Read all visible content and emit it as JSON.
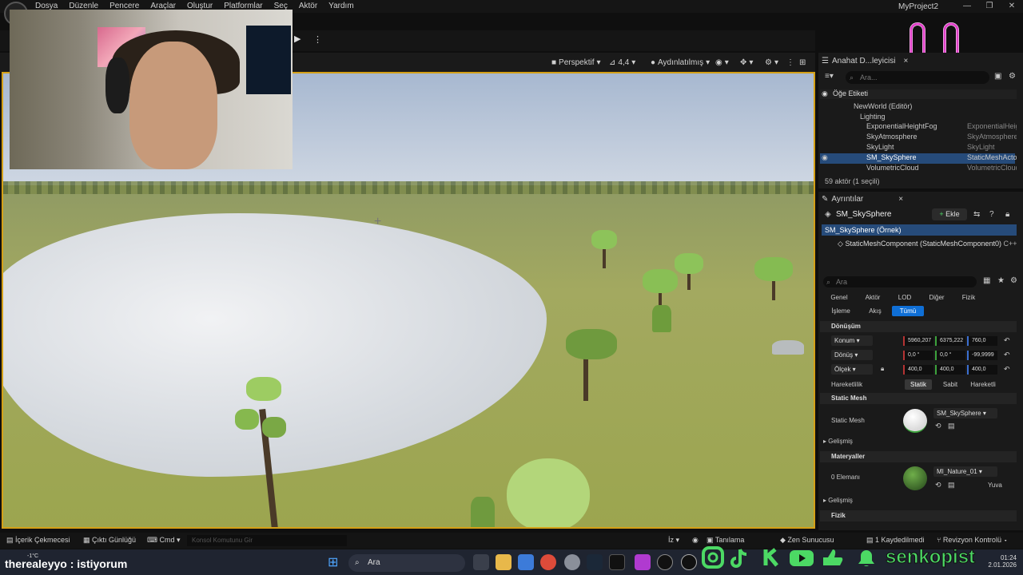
{
  "menu": {
    "items": [
      "Dosya",
      "Düzenle",
      "Pencere",
      "Araçlar",
      "Oluştur",
      "Platformlar",
      "Seç",
      "Aktör",
      "Yardım"
    ],
    "project_title": "MyProject2"
  },
  "viewport": {
    "perspective_label": "Perspektif",
    "fov_label": "4,4",
    "lighting_label": "Aydınlatılmış"
  },
  "outliner": {
    "tab_label": "Anahat D...leyicisi",
    "search_placeholder": "Ara...",
    "column_label": "Öğe Etiketi",
    "rows": [
      {
        "name": "NewWorld (Editör)",
        "type": ""
      },
      {
        "name": "Lighting",
        "type": ""
      },
      {
        "name": "ExponentialHeightFog",
        "type": "ExponentialHeig"
      },
      {
        "name": "SkyAtmosphere",
        "type": "SkyAtmosphere"
      },
      {
        "name": "SkyLight",
        "type": "SkyLight"
      },
      {
        "name": "SM_SkySphere",
        "type": "StaticMeshActo"
      },
      {
        "name": "VolumetricCloud",
        "type": "VolumetricCloud"
      }
    ],
    "actor_count": "59 aktör (1 seçili)"
  },
  "details": {
    "tab_label": "Ayrıntılar",
    "actor_name": "SM_SkySphere",
    "add_label": "Ekle",
    "instance_label": "SM_SkySphere (Örnek)",
    "component_label": "StaticMeshComponent (StaticMeshComponent0)",
    "component_tag": "C++ S",
    "search_placeholder": "Ara",
    "filters_row1": [
      "Genel",
      "Aktör",
      "LOD",
      "Diğer",
      "Fizik"
    ],
    "filters_row2": [
      "İşleme",
      "Akış",
      "Tümü"
    ],
    "transform_header": "Dönüşüm",
    "location_label": "Konum",
    "location_values": [
      "5960,207",
      "6375,222",
      "760,0"
    ],
    "rotation_label": "Dönüş",
    "rotation_values": [
      "0,0 °",
      "0,0 °",
      "-99,9999"
    ],
    "scale_label": "Ölçek",
    "scale_values": [
      "400,0",
      "400,0",
      "400,0"
    ],
    "mobility_label": "Hareketlilik",
    "mobility_options": [
      "Statik",
      "Sabit",
      "Hareketli"
    ],
    "static_mesh_header": "Static Mesh",
    "static_mesh_label": "Static Mesh",
    "static_mesh_value": "SM_SkySphere",
    "advanced_label": "Gelişmiş",
    "materials_header": "Materyaller",
    "materials_label": "0 Elemanı",
    "material_value": "MI_Nature_01",
    "material_extra": "Yuva",
    "advanced_label_2": "Gelişmiş",
    "physics_header": "Fizik"
  },
  "statusbar": {
    "content_drawer": "İçerik Çekmecesi",
    "output_log": "Çıktı Günlüğü",
    "cmd": "Cmd",
    "console_placeholder": "Konsol Komutunu Gir",
    "iz": "İz",
    "diagnostics": "Tanılama",
    "zen": "Zen Sunucusu",
    "saved": "1 Kaydedilmedi",
    "revision": "Revizyon Kontrolü"
  },
  "taskbar": {
    "chat_user": "therealeyyo",
    "chat_message": "istiyorum",
    "search_label": "Ara",
    "channel_name": "senkopist",
    "time": "01:24",
    "date": "2.01.2026",
    "temperature": "-1°C"
  },
  "colors": {
    "viewport_border": "#d4a017",
    "selection": "#264b7a",
    "accent": "#0f6fd6",
    "smiley": "#e040c8",
    "channel": "#4cd964"
  }
}
